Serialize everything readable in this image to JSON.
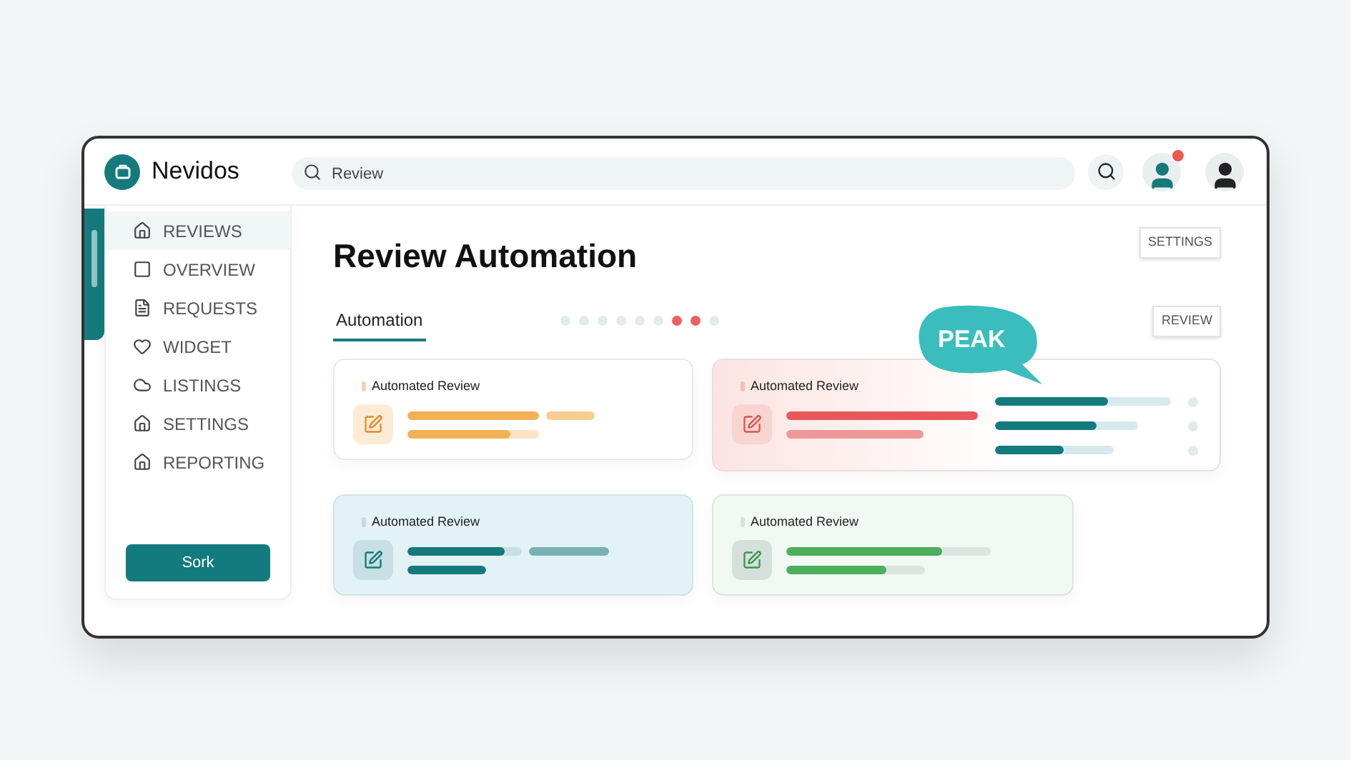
{
  "brand": {
    "name": "Nevidos"
  },
  "search": {
    "value": "Review"
  },
  "avatars": [
    {
      "badge": true
    },
    {
      "badge": false
    }
  ],
  "sidebar": {
    "items": [
      {
        "label": "REVIEWS",
        "kind": "house",
        "selected": true
      },
      {
        "label": "OVERVIEW",
        "kind": "square",
        "selected": false
      },
      {
        "label": "REQUESTS",
        "kind": "list",
        "selected": false
      },
      {
        "label": "WIDGET",
        "kind": "heart",
        "selected": false
      },
      {
        "label": "LISTINGS",
        "kind": "cloud",
        "selected": false
      },
      {
        "label": "SETTINGS",
        "kind": "home",
        "selected": false
      },
      {
        "label": "REPORTING",
        "kind": "home",
        "selected": false
      }
    ],
    "button": "Sork"
  },
  "title": "Review Automation",
  "settings_button": "SETTINGS",
  "tabs": [
    {
      "label": "Automation",
      "selected": true
    }
  ],
  "dots": [
    {
      "color": "#e1eded"
    },
    {
      "color": "#e1eded"
    },
    {
      "color": "#e1eded"
    },
    {
      "color": "#e1eded"
    },
    {
      "color": "#e1eded"
    },
    {
      "color": "#e1eded"
    },
    {
      "color": "#e86262"
    },
    {
      "color": "#e86262"
    },
    {
      "color": "#e1eded"
    }
  ],
  "review_button": "REVIEW",
  "callout": "PEAK",
  "cards": [
    {
      "title": "Automated Review",
      "kind": "orange",
      "rows": [
        [
          {
            "level": 1,
            "muted": false
          },
          {
            "level": 1,
            "muted": true
          }
        ],
        [
          {
            "level": 0.78,
            "muted": false
          }
        ]
      ]
    },
    {
      "title": "Automated Review",
      "kind": "red",
      "rows": [
        [
          {
            "level": 1,
            "muted": false
          }
        ],
        [
          {
            "level": 1,
            "muted": true
          }
        ]
      ],
      "meters": [
        {
          "level": 0.64
        },
        {
          "level": 0.71
        },
        {
          "level": 0.58
        }
      ]
    },
    {
      "title": "Automated Review",
      "kind": "teal",
      "rows": [
        [
          {
            "level": 0.85,
            "muted": false
          },
          {
            "level": 1,
            "muted": true
          }
        ],
        [
          {
            "level": 1,
            "muted": false
          }
        ]
      ]
    },
    {
      "title": "Automated Review",
      "kind": "green",
      "rows": [
        [
          {
            "level": 0.76,
            "muted": false
          }
        ],
        [
          {
            "level": 0.72,
            "muted": false
          }
        ]
      ]
    }
  ]
}
